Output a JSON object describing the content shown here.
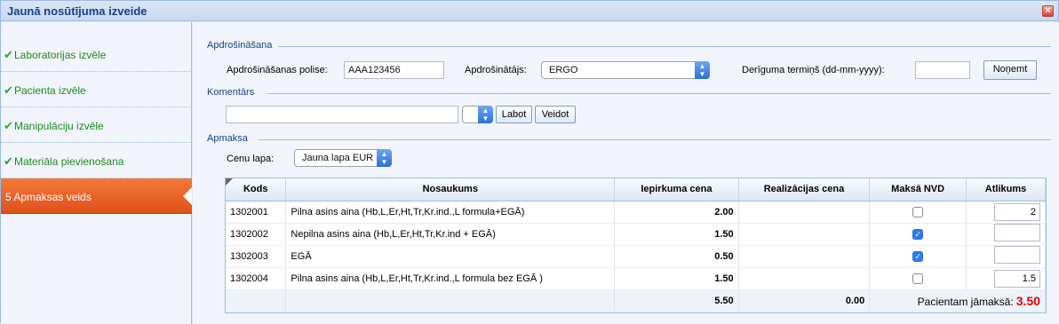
{
  "window": {
    "title": "Jaunā nosūtījuma izveide",
    "close": "×"
  },
  "icons": {
    "check": "✔",
    "close": "close-icon",
    "chevron": "chevron-updown-icon"
  },
  "sidebar": {
    "steps": [
      {
        "label": "Laboratorijas izvēle",
        "done": true
      },
      {
        "label": "Pacienta izvēle",
        "done": true
      },
      {
        "label": "Manipulāciju izvēle",
        "done": true
      },
      {
        "label": "Materiāla pievienošana",
        "done": true
      },
      {
        "label": "5  Apmaksas veids",
        "active": true
      }
    ]
  },
  "insurance": {
    "legend": "Apdrošināšana",
    "policy_label": "Apdrošināšanas polise:",
    "policy_value": "AAA123456",
    "insurer_label": "Apdrošinātājs:",
    "insurer_value": "ERGO",
    "validity_label": "Derīguma termiņš (dd-mm-yyyy):",
    "validity_value": "",
    "remove_label": "Noņemt"
  },
  "comments": {
    "legend": "Komentārs",
    "text_value": "",
    "select_value": "",
    "edit_label": "Labot",
    "create_label": "Veidot"
  },
  "payment": {
    "legend": "Apmaksa",
    "price_list_label": "Cenu lapa:",
    "price_list_value": "Jauna lapa EUR",
    "columns": [
      "Kods",
      "Nosaukums",
      "Iepirkuma cena",
      "Realizācijas cena",
      "Maksā NVD",
      "Atlikums"
    ],
    "rows": [
      {
        "code": "1302001",
        "name": "Pilna asins aina (Hb,L,Er,Ht,Tr,Kr.ind.,L formula+EGĀ)",
        "purchase": "2.00",
        "sale": "",
        "nvd": false,
        "balance": "2"
      },
      {
        "code": "1302002",
        "name": "Nepilna asins aina (Hb,L,Er,Ht,Tr,Kr.ind + EGĀ)",
        "purchase": "1.50",
        "sale": "",
        "nvd": true,
        "balance": ""
      },
      {
        "code": "1302003",
        "name": "EGĀ",
        "purchase": "0.50",
        "sale": "",
        "nvd": true,
        "balance": ""
      },
      {
        "code": "1302004",
        "name": "Pilna asins aina (Hb,L,Er,Ht,Tr,Kr.ind.,L formula bez EGĀ )",
        "purchase": "1.50",
        "sale": "",
        "nvd": false,
        "balance": "1.5"
      }
    ],
    "summary": {
      "purchase_total": "5.50",
      "sale_total": "0.00",
      "patient_label": "Pacientam jāmaksā:",
      "patient_value": "3.50"
    }
  },
  "colors": {
    "accent": "#15428b",
    "active_step": "#e85a20",
    "total": "#e60000",
    "check": "#2fa82f"
  }
}
